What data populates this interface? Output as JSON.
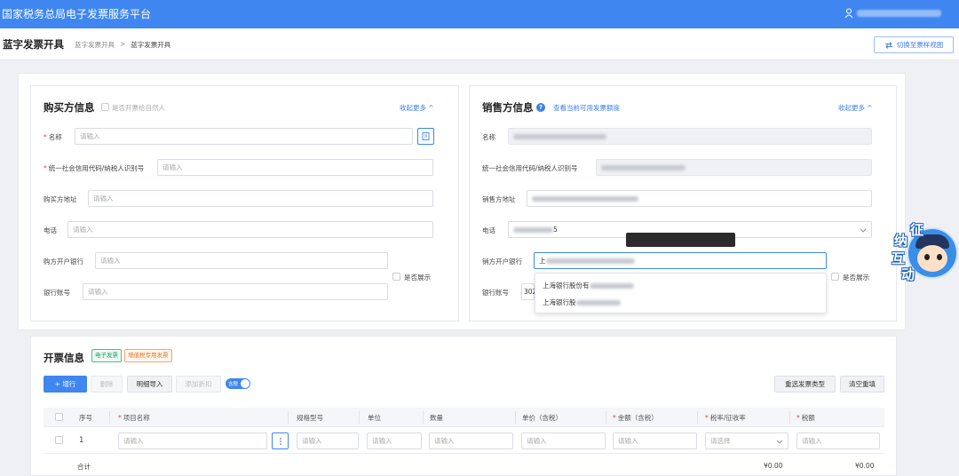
{
  "app": {
    "title": "国家税务总局电子发票服务平台"
  },
  "header": {
    "page_title": "蓝字发票开具",
    "breadcrumb": [
      "蓝字发票开具",
      ">",
      "蓝字发票开具"
    ],
    "switch_label": "切换至票样视图"
  },
  "buyer": {
    "title": "购买方信息",
    "natural_person_label": "是否开票给自然人",
    "collapse_label": "收起更多 ^",
    "fields": {
      "name": {
        "label": "名称",
        "placeholder": "请输入"
      },
      "tax_id": {
        "label": "统一社会信用代码/纳税人识别号",
        "placeholder": "请输入"
      },
      "address": {
        "label": "购买方地址",
        "placeholder": "请输入"
      },
      "phone": {
        "label": "电话",
        "placeholder": "请输入"
      },
      "bank": {
        "label": "购方开户银行",
        "placeholder": "请输入"
      },
      "account": {
        "label": "银行账号",
        "placeholder": "请输入"
      }
    },
    "show_label": "是否展示"
  },
  "seller": {
    "title": "销售方信息",
    "quota_link": "查看当前可用发票额度",
    "collapse_label": "收起更多 ^",
    "fields": {
      "name": {
        "label": "名称"
      },
      "tax_id": {
        "label": "统一社会信用代码/纳税人识别号"
      },
      "address": {
        "label": "销售方地址"
      },
      "phone": {
        "label": "电话",
        "value_end": "5"
      },
      "bank": {
        "label": "销方开户银行",
        "value_prefix": "上"
      },
      "account": {
        "label": "银行账号",
        "value_prefix": "302"
      }
    },
    "show_label": "是否展示",
    "bank_options": [
      {
        "prefix": "上海银行股份有"
      },
      {
        "prefix": "上海银行股"
      }
    ]
  },
  "invoice": {
    "title": "开票信息",
    "tags": [
      "电子发票",
      "增值税专用发票"
    ],
    "toolbar": {
      "add_row": "+ 增行",
      "delete": "删除",
      "detail_import": "明细导入",
      "add_discount": "添加折扣",
      "tax_inclusive": "含税",
      "reselect_type": "重选发票类型",
      "clear_refill": "清空重填"
    },
    "columns": [
      "序号",
      "项目名称",
      "规格型号",
      "单位",
      "数量",
      "单价（含税）",
      "金额（含税）",
      "税率/征收率",
      "税额"
    ],
    "required_marks": [
      "*",
      "*",
      "*",
      "*"
    ],
    "rows": [
      {
        "index": "1",
        "item_placeholder": "请输入",
        "spec_placeholder": "请输入",
        "unit_placeholder": "请输入",
        "qty_placeholder": "请输入",
        "price_placeholder": "请输入",
        "amount_placeholder": "请输入",
        "rate_placeholder": "请选择",
        "tax_placeholder": "请输入"
      }
    ],
    "total_label": "合计",
    "total_amount": "¥0.00",
    "total_tax": "¥0.00"
  },
  "mascot": {
    "chars": [
      "征",
      "纳",
      "互",
      "动"
    ]
  },
  "colors": {
    "primary": "#3f86f0",
    "required": "#e54545",
    "tag_green": "#1f9d61",
    "tag_orange": "#e07a2c"
  }
}
